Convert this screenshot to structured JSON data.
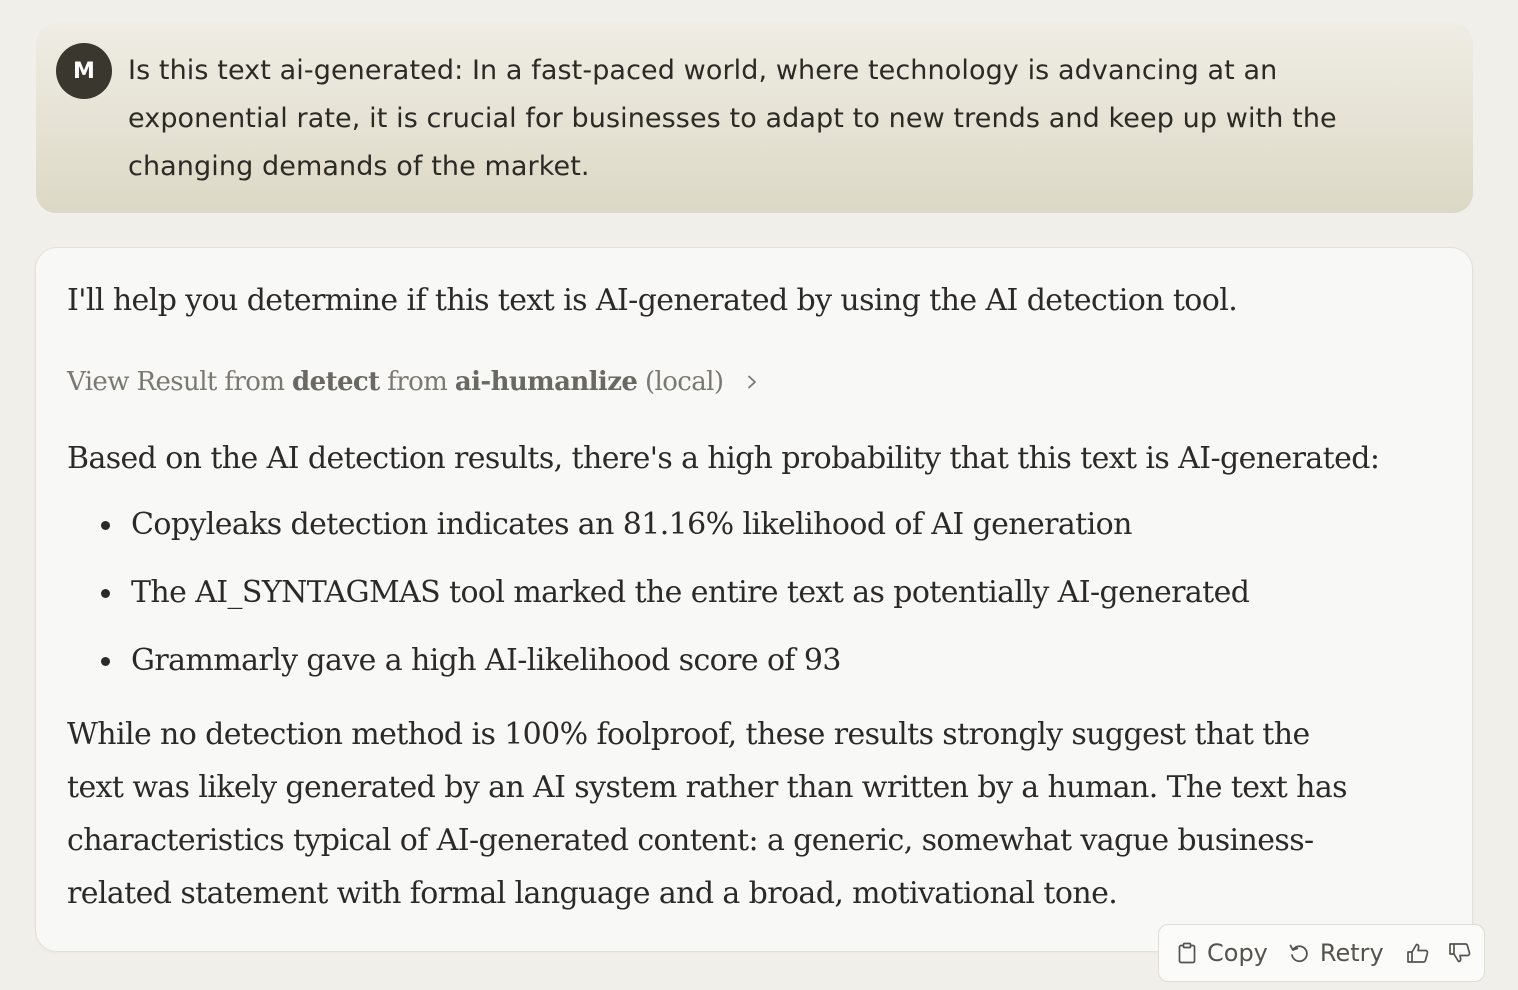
{
  "user_message": {
    "avatar_initial": "M",
    "text": "Is this text ai-generated:  In a fast-paced world, where technology is advancing at an exponential rate, it is crucial for businesses to adapt to new trends and keep up with the changing demands of the market."
  },
  "assistant_message": {
    "intro": "I'll help you determine if this text is AI-generated by using the AI detection tool.",
    "tool_result": {
      "prefix": "View Result from ",
      "tool_name": "detect",
      "middle": " from ",
      "server_name": "ai-humanlize",
      "suffix": " (local)",
      "icon": "chevron-right-icon"
    },
    "summary": "Based on the AI detection results, there's a high probability that this text is AI-generated:",
    "bullets": [
      "Copyleaks detection indicates an 81.16% likelihood of AI generation",
      "The AI_SYNTAGMAS tool marked the entire text as potentially AI-generated",
      "Grammarly gave a high AI-likelihood score of 93"
    ],
    "conclusion": "While no detection method is 100% foolproof, these results strongly suggest that the text was likely generated by an AI system rather than written by a human. The text has characteristics typical of AI-generated content: a generic, somewhat vague business-related statement with formal language and a broad, motivational tone."
  },
  "actions": {
    "copy_label": "Copy",
    "retry_label": "Retry",
    "icons": [
      "clipboard-icon",
      "retry-icon",
      "thumbs-up-icon",
      "thumbs-down-icon"
    ]
  },
  "colors": {
    "page_background": "#f0efe9",
    "user_bubble": "#e5e2d4",
    "avatar": "#3a372f",
    "assistant_card": "#f8f8f6",
    "text": "#2b2a26",
    "muted_text": "#7a7871"
  }
}
